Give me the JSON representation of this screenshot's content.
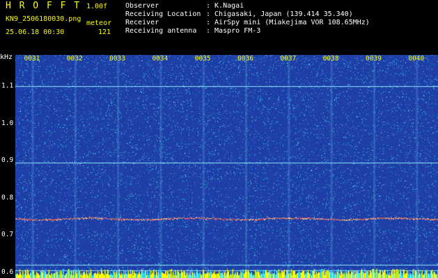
{
  "header": {
    "brand": "H R O F F T",
    "version": "1.00f",
    "filename": "KN9_2506180030.png",
    "mode": "meteor",
    "datetime": "25.06.18 00:30",
    "count": "121"
  },
  "info": {
    "labels": [
      "Observer",
      "Receiving Location",
      "Receiver",
      "Receiving antenna"
    ],
    "values": [
      ": K.Nagai",
      ": Chigasaki, Japan (139.414 35.340)",
      ": AirSpy mini (Miakejima VOR 108.65MHz)",
      ": Maspro FM-3"
    ]
  },
  "spectrogram": {
    "unit": "kHz",
    "y_ticks": [
      "1.1",
      "1.0",
      "0.9",
      "0.8",
      "0.7",
      "0.6"
    ],
    "y_tick_values": [
      1.1,
      1.0,
      0.9,
      0.8,
      0.7,
      0.6
    ],
    "y_range": [
      0.585,
      1.185
    ],
    "x_ticks": [
      "0031",
      "0032",
      "0033",
      "0034",
      "0035",
      "0036",
      "0037",
      "0038",
      "0039",
      "0040"
    ],
    "x_tick_values": [
      31,
      32,
      33,
      34,
      35,
      36,
      37,
      38,
      39,
      40
    ],
    "x_range": [
      30.6,
      40.5
    ],
    "horizontal_lines_khz": [
      1.1,
      0.895,
      0.62,
      0.605
    ],
    "meteor_trace_khz": 0.745,
    "colors": {
      "background": "#1e3fa8",
      "noise": "#36c8e8",
      "trace": "#ff5a5a",
      "bottom_bar": "#ffff00",
      "label": "#ffff00"
    }
  }
}
